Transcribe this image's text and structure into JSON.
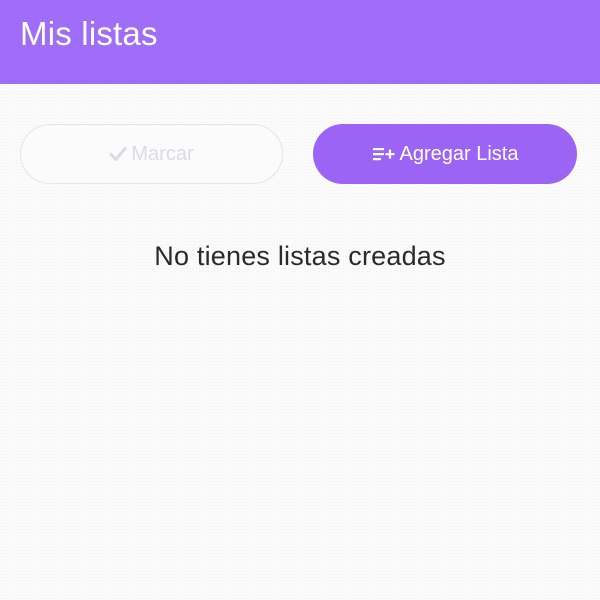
{
  "header": {
    "title": "Mis listas",
    "color": "#9f6cf8"
  },
  "actions": {
    "mark_label": "Marcar",
    "mark_icon": "check-icon",
    "mark_disabled": true,
    "add_label": "Agregar Lista",
    "add_icon": "playlist-add-icon",
    "accent": "#9c64f4"
  },
  "main": {
    "empty_message": "No tienes listas creadas"
  }
}
